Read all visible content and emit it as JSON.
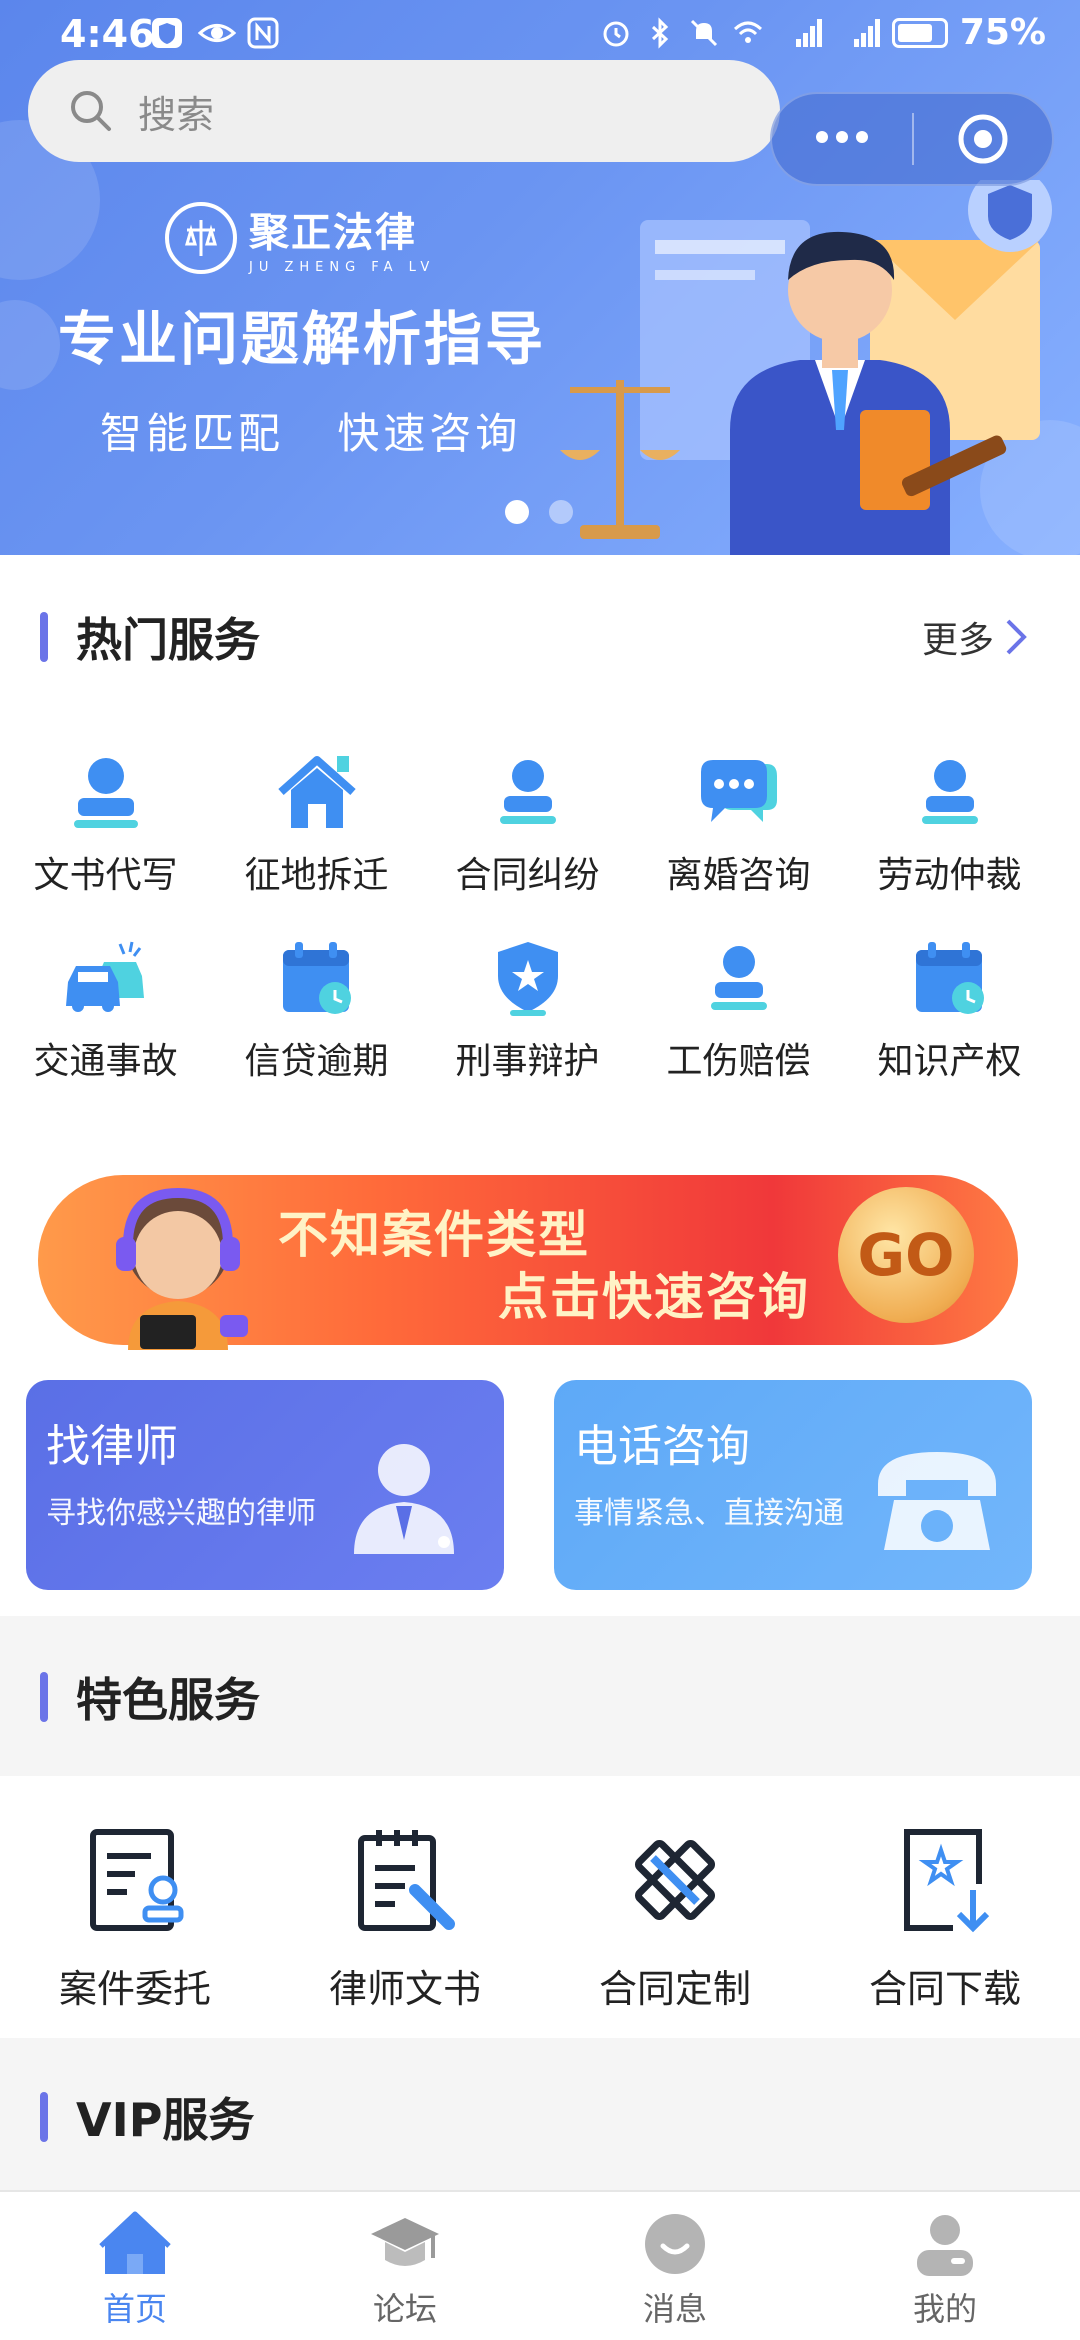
{
  "status_bar": {
    "time": "4:46",
    "battery": "75%"
  },
  "search": {
    "placeholder": "搜索"
  },
  "banner": {
    "brand_name": "聚正法律",
    "brand_pinyin": "JU ZHENG FA LV",
    "headline": "专业问题解析指导",
    "tag1": "智能匹配",
    "tag2": "快速咨询",
    "dots_total": 2,
    "active_dot": 1
  },
  "hot_services": {
    "title": "热门服务",
    "more_label": "更多",
    "items": [
      {
        "label": "文书代写",
        "icon": "person-stamp-icon"
      },
      {
        "label": "征地拆迁",
        "icon": "house-icon"
      },
      {
        "label": "合同纠纷",
        "icon": "person-stamp-icon"
      },
      {
        "label": "离婚咨询",
        "icon": "chat-bubbles-icon"
      },
      {
        "label": "劳动仲裁",
        "icon": "person-stamp-icon"
      },
      {
        "label": "交通事故",
        "icon": "cars-icon"
      },
      {
        "label": "信贷逾期",
        "icon": "calendar-clock-icon"
      },
      {
        "label": "刑事辩护",
        "icon": "shield-star-icon"
      },
      {
        "label": "工伤赔偿",
        "icon": "person-stamp-icon"
      },
      {
        "label": "知识产权",
        "icon": "calendar-clock-icon"
      }
    ]
  },
  "promo": {
    "line1": "不知案件类型",
    "line2": "点击快速咨询",
    "go_label": "GO"
  },
  "cards": {
    "find_lawyer": {
      "title": "找律师",
      "subtitle": "寻找你感兴趣的律师"
    },
    "phone_consult": {
      "title": "电话咨询",
      "subtitle": "事情紧急、直接沟通"
    }
  },
  "featured": {
    "title": "特色服务",
    "items": [
      {
        "label": "案件委托",
        "icon": "document-person-icon"
      },
      {
        "label": "律师文书",
        "icon": "clipboard-pen-icon"
      },
      {
        "label": "合同定制",
        "icon": "ruler-pencil-icon"
      },
      {
        "label": "合同下载",
        "icon": "file-download-icon"
      }
    ]
  },
  "vip": {
    "title": "VIP服务"
  },
  "tabbar": {
    "items": [
      {
        "label": "首页",
        "icon": "home-icon",
        "active": true
      },
      {
        "label": "论坛",
        "icon": "graduation-cap-icon",
        "active": false
      },
      {
        "label": "消息",
        "icon": "message-bubble-icon",
        "active": false
      },
      {
        "label": "我的",
        "icon": "profile-icon",
        "active": false
      }
    ]
  },
  "colors": {
    "accent": "#4a86f0",
    "section_bar": "#6b74e8",
    "service_icon_blue": "#3f8ff2",
    "service_icon_cyan": "#4fd2e0"
  }
}
